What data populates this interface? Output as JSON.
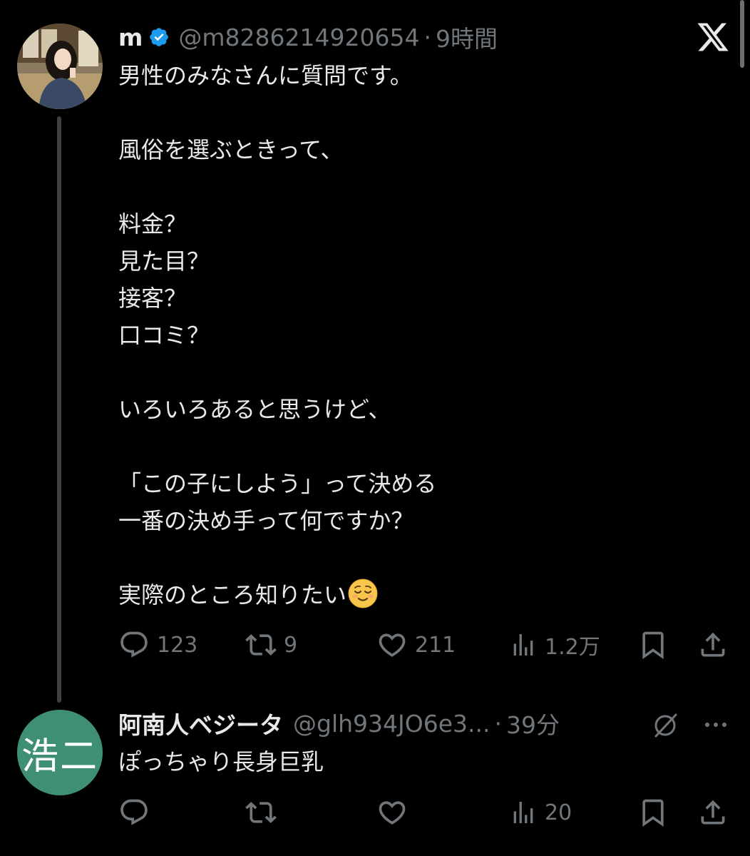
{
  "post": {
    "author_name": "m",
    "handle": "@m8286214920654",
    "separator": "·",
    "time": "9時間",
    "body": "男性のみなさんに質問です。\n\n風俗を選ぶときって、\n\n料金？\n見た目？\n接客？\n口コミ？\n\nいろいろあると思うけど、\n\n「この子にしよう」って決める\n一番の決め手って何ですか？\n\n実際のところ知りたい",
    "emoji": "relieved-face",
    "stats": {
      "replies": "123",
      "reposts": "9",
      "likes": "211",
      "views": "1.2万"
    }
  },
  "reply": {
    "avatar_text": "浩二",
    "author_name": "阿南人ベジータ",
    "handle": "@glh934JO6e3...",
    "separator": "·",
    "time": "39分",
    "body": "ぽっちゃり長身巨乳",
    "stats": {
      "views": "20"
    },
    "avatar_color": "#3f8f77"
  },
  "colors": {
    "background": "#000000",
    "text": "#e7e9ea",
    "muted": "#71767b",
    "verified": "#1d9bf0"
  }
}
